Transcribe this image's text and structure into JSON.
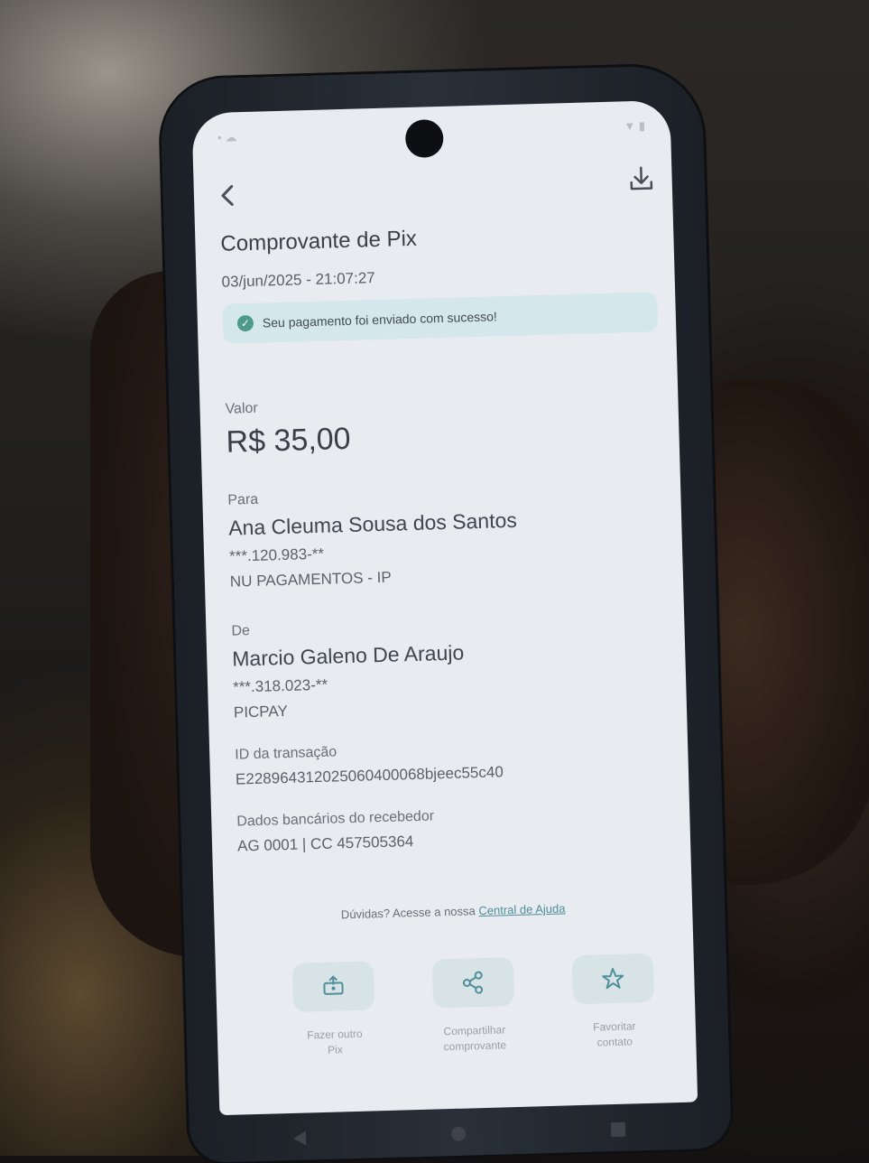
{
  "header": {
    "title": "Comprovante de Pix",
    "datetime": "03/jun/2025 - 21:07:27",
    "back_icon": "chevron-left-icon",
    "download_icon": "download-icon"
  },
  "banner": {
    "text": "Seu pagamento foi enviado com sucesso!",
    "icon": "check-circle-icon",
    "color": "#4f9a8f"
  },
  "amount": {
    "label": "Valor",
    "value": "R$ 35,00"
  },
  "recipient": {
    "label": "Para",
    "name": "Ana Cleuma Sousa dos Santos",
    "document": "***.120.983-**",
    "institution": "NU PAGAMENTOS - IP"
  },
  "sender": {
    "label": "De",
    "name": "Marcio Galeno De Araujo",
    "document": "***.318.023-**",
    "institution": "PICPAY"
  },
  "transaction": {
    "label": "ID da transação",
    "id": "E22896431202506040006 8bjeec55c40"
  },
  "bank_details": {
    "label": "Dados bancários do recebedor",
    "value": "AG 0001 | CC 457505364"
  },
  "help": {
    "text": "Dúvidas? Acesse a nossa",
    "link": "Central de Ajuda"
  },
  "actions": [
    {
      "label_line1": "Fazer outro",
      "label_line2": "Pix",
      "icon": "new-pix-icon"
    },
    {
      "label_line1": "Compartilhar",
      "label_line2": "comprovante",
      "icon": "share-icon"
    },
    {
      "label_line1": "Favoritar",
      "label_line2": "contato",
      "icon": "star-icon"
    }
  ]
}
